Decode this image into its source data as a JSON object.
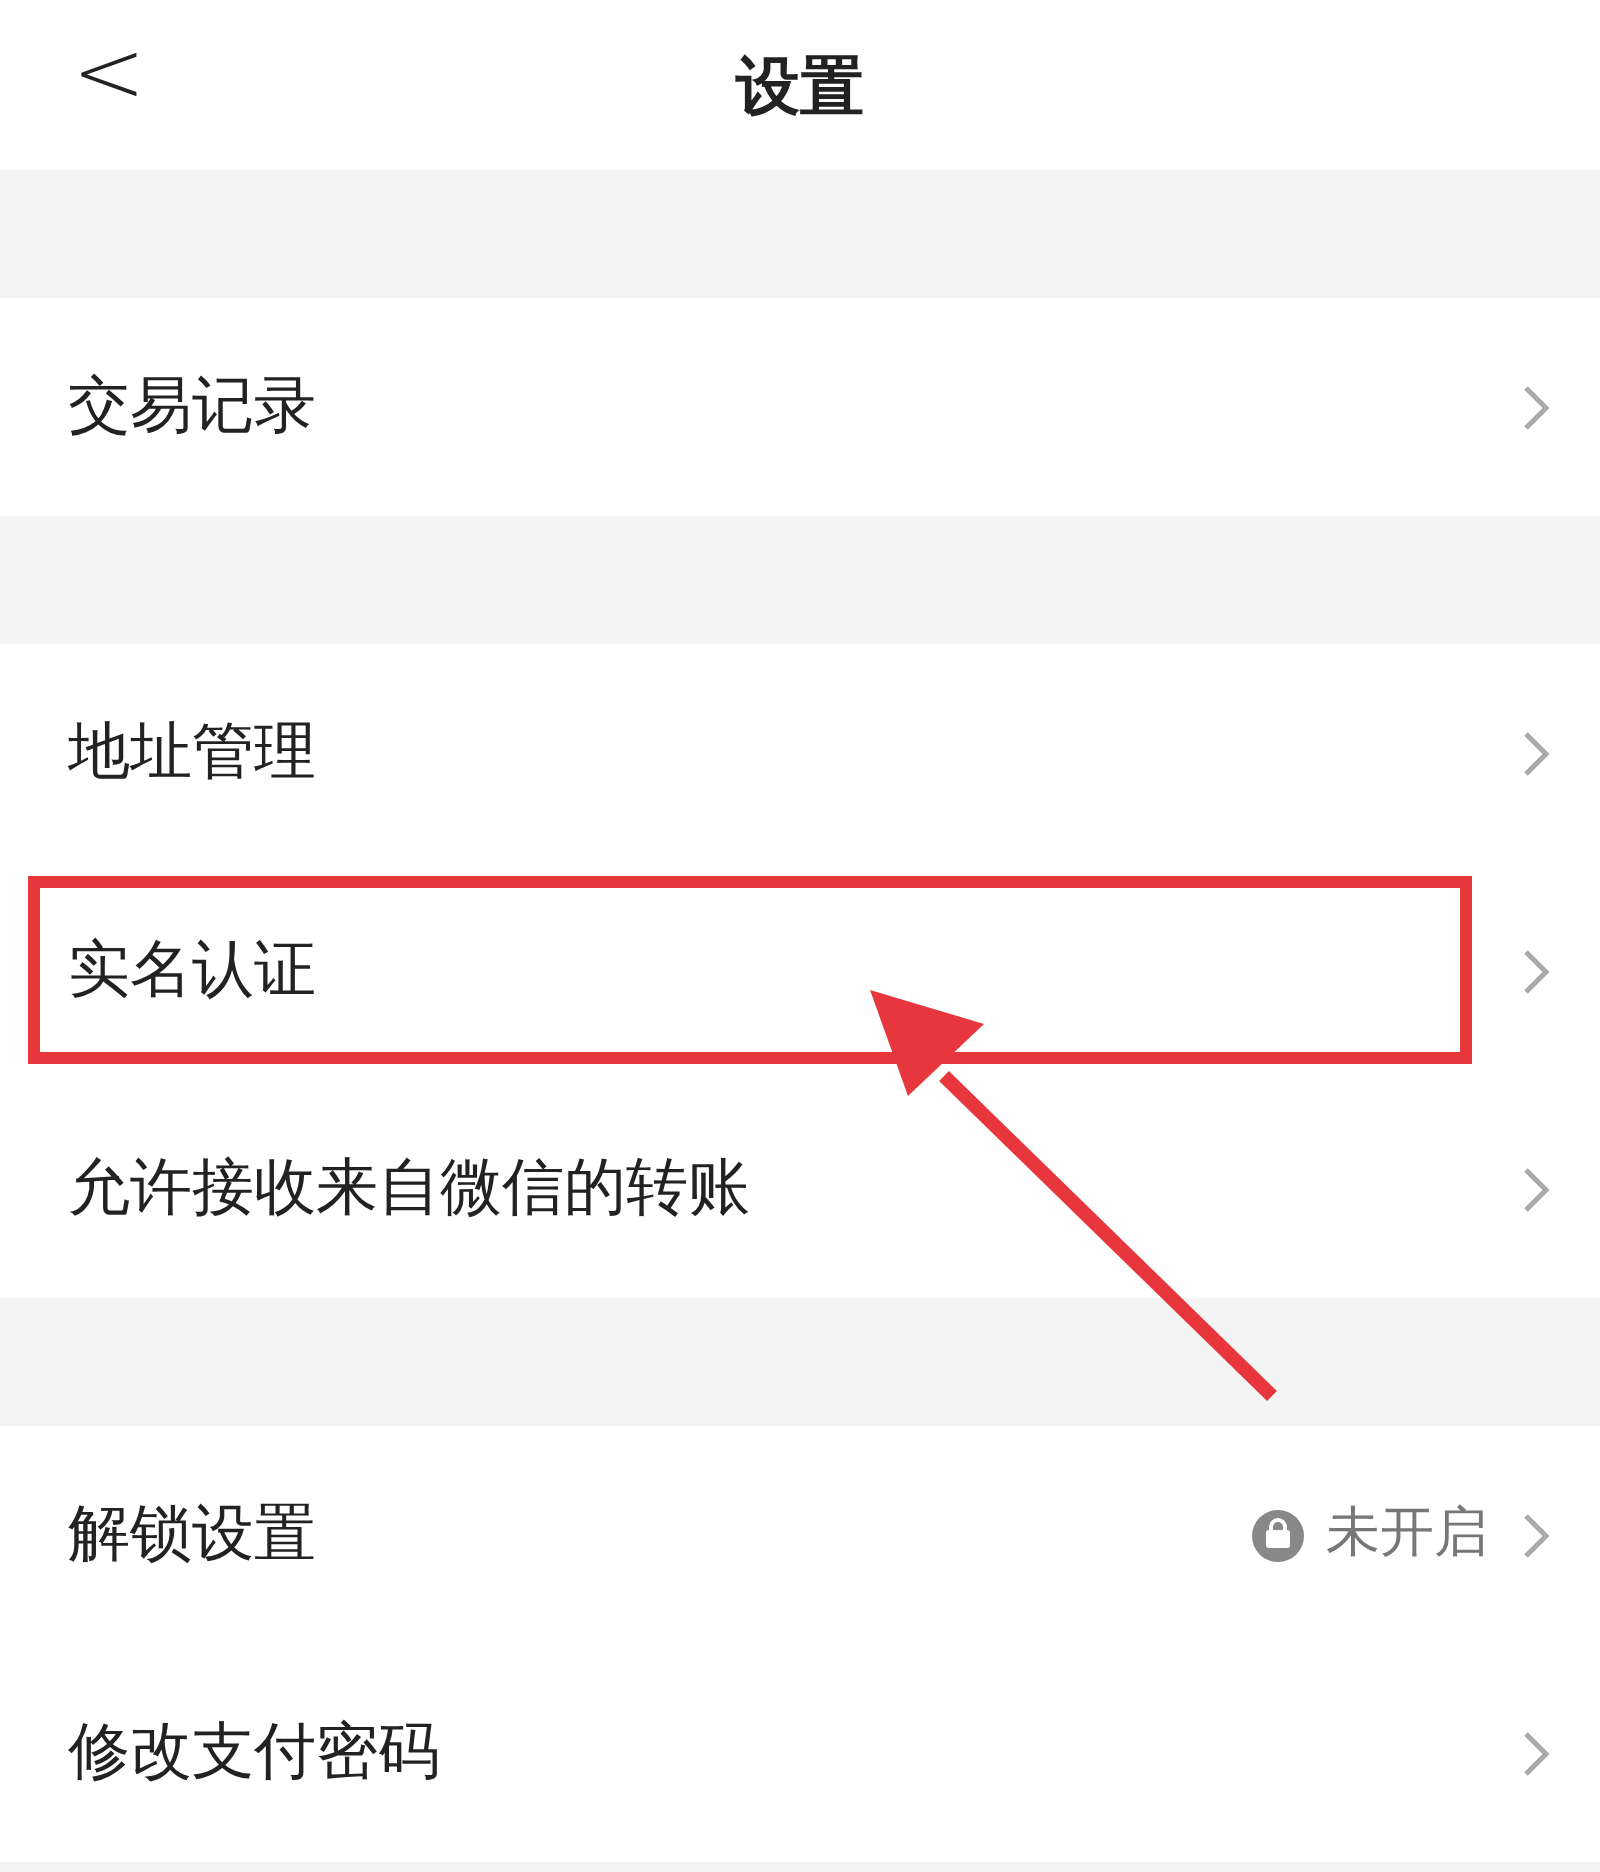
{
  "header": {
    "back": "<",
    "title": "设置"
  },
  "sections": [
    {
      "rows": [
        {
          "label": "交易记录",
          "highlighted": false
        }
      ]
    },
    {
      "rows": [
        {
          "label": "地址管理",
          "highlighted": false
        },
        {
          "label": "实名认证",
          "highlighted": true
        },
        {
          "label": "允许接收来自微信的转账",
          "highlighted": false
        }
      ]
    },
    {
      "rows": [
        {
          "label": "解锁设置",
          "status": "未开启",
          "highlighted": false
        },
        {
          "label": "修改支付密码",
          "highlighted": false
        }
      ]
    }
  ]
}
